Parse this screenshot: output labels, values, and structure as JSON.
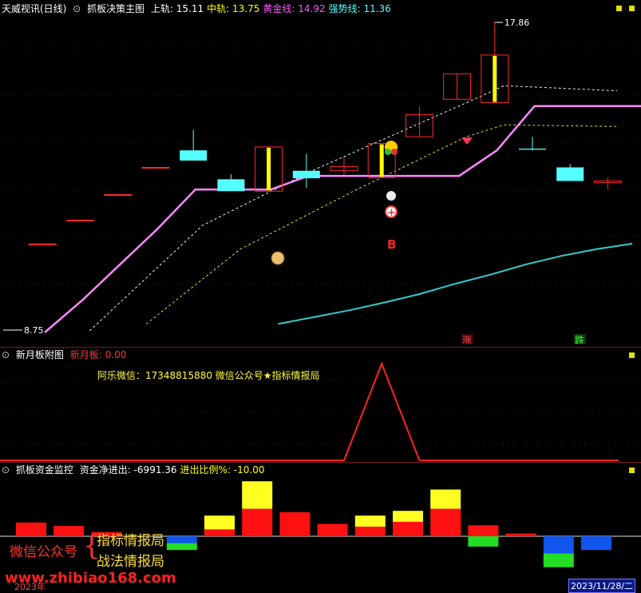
{
  "main_header": {
    "app_title": "天威视讯(日线)",
    "indicator": "抓板决策主图",
    "items": [
      {
        "label": "上轨:",
        "value": "15.11",
        "color": "#ffffff"
      },
      {
        "label": "中轨:",
        "value": "13.75",
        "color": "#ffff00"
      },
      {
        "label": "黄金线:",
        "value": "14.92",
        "color": "#ff55ff"
      },
      {
        "label": "强势线:",
        "value": "11.36",
        "color": "#55ffff"
      }
    ]
  },
  "main_chart": {
    "high_label": "17.86",
    "low_label": "8.75",
    "buy_label": "B",
    "rise_badge": "涨",
    "fall_badge": "跌"
  },
  "sub_header": {
    "indicator": "新月板附图",
    "label": "新月板:",
    "value": "0.00",
    "note": "阿乐微信：17348815880  微信公众号★指标情报局"
  },
  "flow_header": {
    "indicator": "抓板资金监控",
    "items": [
      {
        "label": "资金净进出:",
        "value": "-6991.36",
        "color": "#ffffff"
      },
      {
        "label": "进出比例%:",
        "value": "-10.00",
        "color": "#ffff00"
      }
    ]
  },
  "watermark": {
    "left": "微信公众号",
    "right_top": "指标情报局",
    "right_bottom": "战法情报局",
    "site": "www.zhibiao168.com",
    "year": "2023年",
    "date": "2023/11/28/二"
  },
  "colors": {
    "up": "#ff2a2a",
    "down": "#55ffff",
    "gold": "#ff88ff",
    "strong": "#33cccc",
    "yellow": "#ffff00",
    "green": "#22dd22"
  },
  "chart_data": {
    "type": "candlestick",
    "price_range": [
      8.75,
      17.86
    ],
    "candles": [
      {
        "o": 11.35,
        "c": 11.35
      },
      {
        "o": 12.05,
        "c": 12.05
      },
      {
        "o": 12.8,
        "c": 12.8
      },
      {
        "o": 13.6,
        "c": 13.6
      },
      {
        "o": 14.1,
        "c": 13.8,
        "h": 14.7,
        "l": 13.8
      },
      {
        "o": 13.25,
        "c": 12.9,
        "h": 13.4,
        "l": 12.9
      },
      {
        "o": 12.9,
        "c": 14.2,
        "h": 14.2,
        "l": 12.9
      },
      {
        "o": 13.5,
        "c": 13.28,
        "h": 14.0,
        "l": 13.0
      },
      {
        "o": 13.5,
        "c": 13.62,
        "h": 13.9,
        "l": 13.4
      },
      {
        "o": 13.3,
        "c": 14.3,
        "h": 14.3,
        "l": 13.3
      },
      {
        "o": 14.5,
        "c": 15.15,
        "h": 15.4,
        "l": 14.5
      },
      {
        "o": 15.6,
        "c": 16.35,
        "h": 16.35,
        "l": 15.6
      },
      {
        "o": 15.5,
        "c": 16.9,
        "h": 17.86,
        "l": 15.5
      },
      {
        "o": 14.15,
        "c": 14.12,
        "h": 14.5,
        "l": 14.1
      },
      {
        "o": 13.6,
        "c": 13.2,
        "h": 13.7,
        "l": 13.2
      },
      {
        "o": 13.15,
        "c": 13.2,
        "h": 13.3,
        "l": 12.95
      }
    ],
    "gold_line": [
      8.75,
      9.7,
      10.75,
      11.8,
      12.95,
      12.95,
      12.95,
      13.35,
      13.35,
      13.35,
      13.35,
      13.35,
      14.1,
      15.4,
      15.4,
      15.4,
      15.4
    ],
    "strong_line": [
      9.0,
      9.2,
      9.4,
      9.63,
      9.88,
      10.18,
      10.45,
      10.75,
      11.0,
      11.2,
      11.36
    ],
    "sub_values": [
      0,
      0,
      0,
      0,
      0,
      0,
      0,
      0,
      0,
      1,
      0,
      0,
      0,
      0,
      0,
      0
    ],
    "flow": [
      {
        "red": 2,
        "yellow": 0,
        "green": 0,
        "blue": 0
      },
      {
        "red": 1.5,
        "yellow": 0,
        "green": 0,
        "blue": 0
      },
      {
        "red": 0.6,
        "yellow": 0,
        "green": 0,
        "blue": 0
      },
      {
        "red": 0,
        "yellow": 0,
        "green": 0,
        "blue": 0
      },
      {
        "red": 0,
        "yellow": 0,
        "green": -1,
        "blue": -1
      },
      {
        "red": 1,
        "yellow": 2,
        "green": 0,
        "blue": 0
      },
      {
        "red": 4,
        "yellow": 4,
        "green": 0,
        "blue": 0
      },
      {
        "red": 3.5,
        "yellow": 0,
        "green": 0,
        "blue": 0
      },
      {
        "red": 1.8,
        "yellow": 0,
        "green": 0,
        "blue": 0
      },
      {
        "red": 1.4,
        "yellow": 1.6,
        "green": 0,
        "blue": 0
      },
      {
        "red": 2.1,
        "yellow": 1.6,
        "green": 0,
        "blue": 0
      },
      {
        "red": 4,
        "yellow": 2.8,
        "green": 0,
        "blue": 0
      },
      {
        "red": 1.6,
        "yellow": 0,
        "green": -1.5,
        "blue": 0
      },
      {
        "red": 0.4,
        "yellow": 0,
        "green": 0,
        "blue": 0
      },
      {
        "red": 0,
        "yellow": 0,
        "green": -2,
        "blue": -2.5
      },
      {
        "red": 0,
        "yellow": 0,
        "green": 0,
        "blue": -2
      }
    ]
  }
}
